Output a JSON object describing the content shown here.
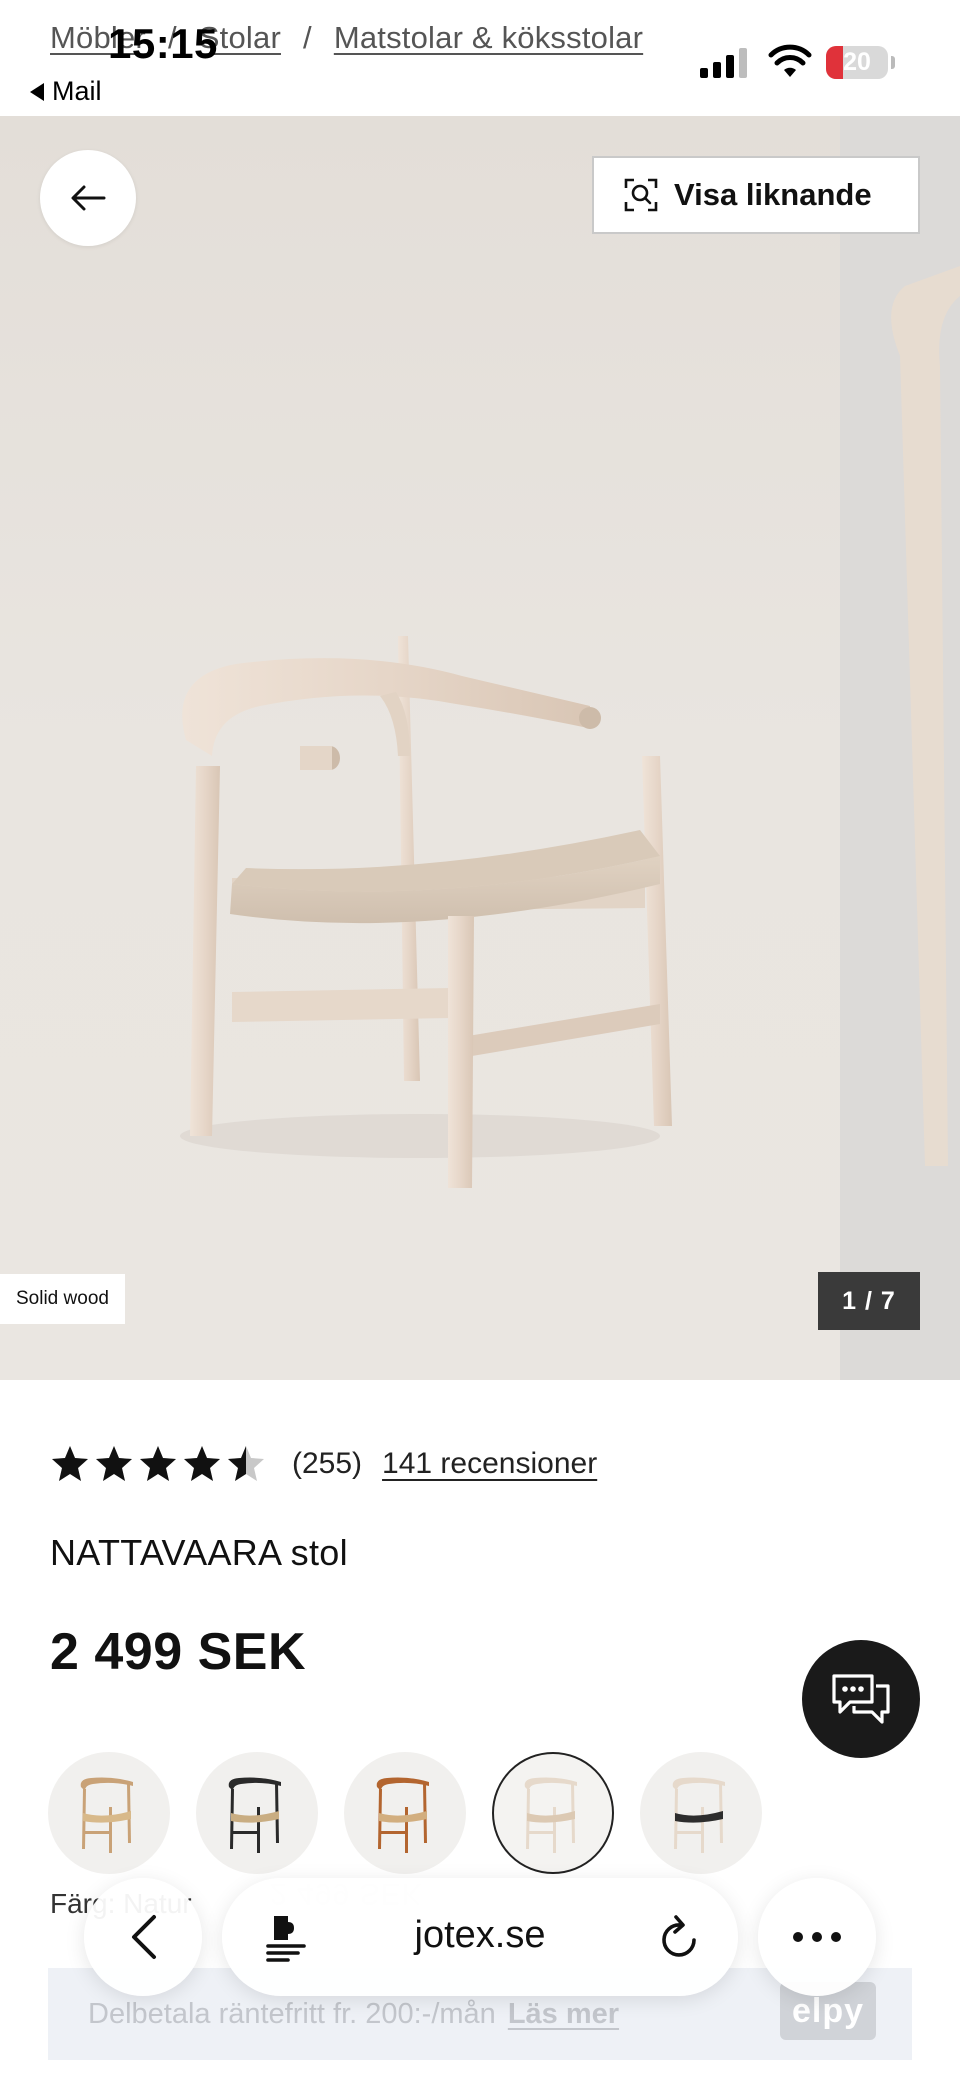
{
  "status_bar": {
    "time": "15:15",
    "back_app": "Mail",
    "battery": "20"
  },
  "breadcrumb": {
    "items": [
      "Möbler",
      "Stolar",
      "Matstolar & köksstolar"
    ],
    "separator": "/"
  },
  "gallery": {
    "similar_label": "Visa liknande",
    "badge": "Solid wood",
    "counter": "1 / 7"
  },
  "product": {
    "rating_value": 4.5,
    "rating_count": "(255)",
    "reviews_link": "141 recensioner",
    "name": "NATTAVAARA stol",
    "price": "2 499 SEK",
    "color_label": "Färg: Natur",
    "swatches": [
      {
        "name": "oak-natural-paper",
        "frame": "#c9a277",
        "seat": "#d8b98a",
        "selected": false
      },
      {
        "name": "black-natural-paper",
        "frame": "#2a2a2a",
        "seat": "#c9ad82",
        "selected": false
      },
      {
        "name": "teak-natural-paper",
        "frame": "#b3652f",
        "seat": "#d2ae7f",
        "selected": false
      },
      {
        "name": "whitewash-natural-paper",
        "frame": "#e6d9cb",
        "seat": "#dcc9b3",
        "selected": true
      },
      {
        "name": "whitewash-black-paper",
        "frame": "#e6d9cb",
        "seat": "#2d2d2d",
        "selected": false
      }
    ]
  },
  "financing": {
    "text": "Delbetala räntefritt fr. 200:-/mån",
    "link": "Läs mer",
    "logo": "elpy"
  },
  "browser": {
    "host": "jotex.se"
  },
  "colors": {
    "text": "#111111",
    "chat_button": "#1a1a1a",
    "counter_bg": "#3a3a3a",
    "battery_low": "#e0323a"
  }
}
